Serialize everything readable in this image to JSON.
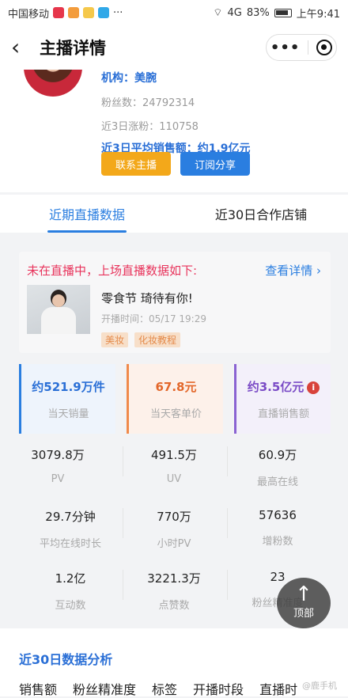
{
  "status_bar": {
    "carrier": "中国移动",
    "signal": "4G",
    "battery": "83%",
    "time": "上午9:41",
    "app_icon_colors": [
      "#e6364b",
      "#f39c3c",
      "#f5c84b",
      "#30a8e8"
    ]
  },
  "nav": {
    "back_icon": "‹",
    "title": "主播详情",
    "more_icon": "•••"
  },
  "profile": {
    "org": "机构：美腕",
    "fans": "粉丝数：24792314",
    "recent_growth": "近3日涨粉：110758",
    "avg_sales": "近3日平均销售额：约1.9亿元",
    "contact_button": "联系主播",
    "subscribe_button": "订阅分享"
  },
  "tabs": [
    {
      "label": "近期直播数据",
      "active": true
    },
    {
      "label": "近30日合作店铺",
      "active": false
    }
  ],
  "live": {
    "status": "未在直播中，上场直播数据如下:",
    "detail_link": "查看详情 ›",
    "title": "零食节 琦待有你!",
    "time": "开播时间：05/17 19:29",
    "tags": [
      "美妆",
      "化妆教程"
    ]
  },
  "stat_cards": [
    {
      "value": "约521.9万件",
      "label": "当天销量"
    },
    {
      "value": "67.8元",
      "label": "当天客单价"
    },
    {
      "value": "约3.5亿元",
      "label": "直播销售额",
      "icon": "i"
    }
  ],
  "metrics": [
    {
      "value": "3079.8万",
      "label": "PV"
    },
    {
      "value": "491.5万",
      "label": "UV"
    },
    {
      "value": "60.9万",
      "label": "最高在线"
    },
    {
      "value": "29.7分钟",
      "label": "平均在线时长"
    },
    {
      "value": "770万",
      "label": "小时PV"
    },
    {
      "value": "57636",
      "label": "增粉数"
    },
    {
      "value": "1.2亿",
      "label": "互动数"
    },
    {
      "value": "3221.3万",
      "label": "点赞数"
    },
    {
      "value": "23",
      "label": "粉丝精准度"
    }
  ],
  "top_button": {
    "icon": "↑",
    "label": "顶部"
  },
  "analysis": {
    "title": "近30日数据分析",
    "tabs": [
      "销售额",
      "粉丝精准度",
      "标签",
      "开播时段",
      "直播时"
    ],
    "watermark": "@鹿手机"
  }
}
